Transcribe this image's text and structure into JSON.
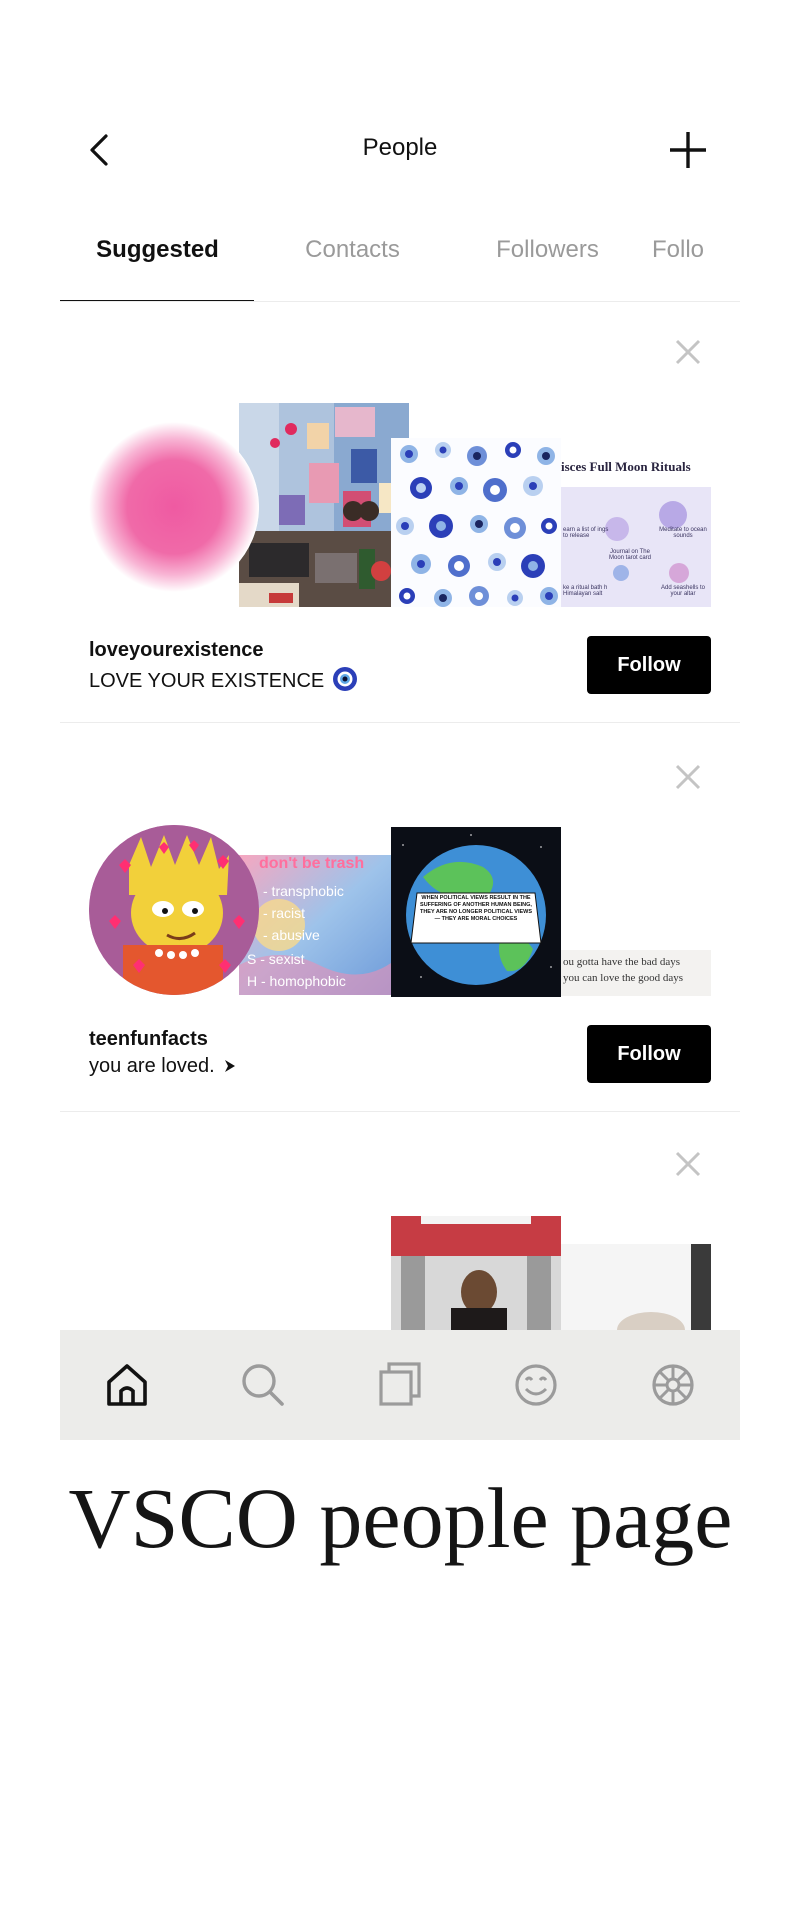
{
  "header": {
    "title": "People"
  },
  "tabs": [
    {
      "label": "Suggested",
      "active": true
    },
    {
      "label": "Contacts",
      "active": false
    },
    {
      "label": "Followers",
      "active": false
    },
    {
      "label": "Follo",
      "active": false
    }
  ],
  "cards": [
    {
      "username": "loveyourexistence",
      "bio": "LOVE YOUR EXISTENCE",
      "follow_label": "Follow",
      "thumb_texts": {
        "moon_rituals": "isces Full Moon Rituals",
        "moon_left": "earn a list of ings to release",
        "moon_center": "Journal on The Moon tarot card",
        "moon_right": "Meditate to ocean sounds",
        "moon_bottom_left": "ke a ritual bath h Himalayan salt",
        "moon_bottom_right": "Add seashells to your altar"
      }
    },
    {
      "username": "teenfunfacts",
      "bio": "you are loved.",
      "follow_label": "Follow",
      "thumb_texts": {
        "trash_title": "don't be trash",
        "trash_lines": [
          "- transphobic",
          "- racist",
          "- abusive",
          "S - sexist",
          "H - homophobic"
        ],
        "political": "WHEN POLITICAL VIEWS RESULT IN THE SUFFERING OF ANOTHER HUMAN BEING, THEY ARE NO LONGER POLITICAL VIEWS — THEY ARE MORAL CHOICES",
        "quote_line1": "ou gotta have the bad days",
        "quote_line2": "you can love the good days"
      }
    }
  ],
  "nav": [
    "home-icon",
    "search-icon",
    "gallery-icon",
    "smiley-icon",
    "settings-wheel-icon"
  ],
  "caption": "VSCO people page",
  "colors": {
    "follow_bg": "#000000",
    "accent_pink": "#f06aa8",
    "evil_eye_blue": "#2b3fb8"
  }
}
